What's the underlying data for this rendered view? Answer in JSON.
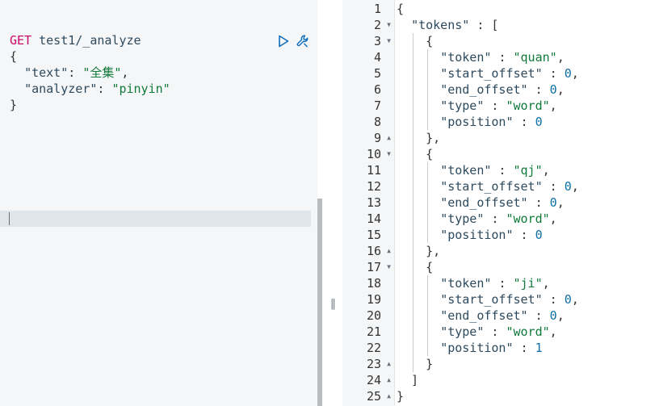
{
  "request": {
    "method": "GET",
    "path": "test1/_analyze",
    "body": {
      "open": "{",
      "text_key": "\"text\"",
      "text_value": "\"全集\"",
      "analyzer_key": "\"analyzer\"",
      "analyzer_value": "\"pinyin\"",
      "close": "}"
    }
  },
  "actions": {
    "run_icon": "play-icon",
    "settings_icon": "wrench-icon"
  },
  "divider": {
    "handle": "||"
  },
  "response": {
    "line_numbers": [
      "1",
      "2",
      "3",
      "4",
      "5",
      "6",
      "7",
      "8",
      "9",
      "10",
      "11",
      "12",
      "13",
      "14",
      "15",
      "16",
      "17",
      "18",
      "19",
      "20",
      "21",
      "22",
      "23",
      "24",
      "25"
    ],
    "tokens_key": "\"tokens\"",
    "token_key": "\"token\"",
    "start_offset_key": "\"start_offset\"",
    "end_offset_key": "\"end_offset\"",
    "type_key": "\"type\"",
    "position_key": "\"position\"",
    "tokens": [
      {
        "token": "\"quan\"",
        "start_offset": "0",
        "end_offset": "0",
        "type": "\"word\"",
        "position": "0"
      },
      {
        "token": "\"qj\"",
        "start_offset": "0",
        "end_offset": "0",
        "type": "\"word\"",
        "position": "0"
      },
      {
        "token": "\"ji\"",
        "start_offset": "0",
        "end_offset": "0",
        "type": "\"word\"",
        "position": "1"
      }
    ]
  },
  "colors": {
    "method": "#c80a68",
    "key": "#2e4a5e",
    "string": "#0f7a3a",
    "number": "#0d6fa6"
  }
}
